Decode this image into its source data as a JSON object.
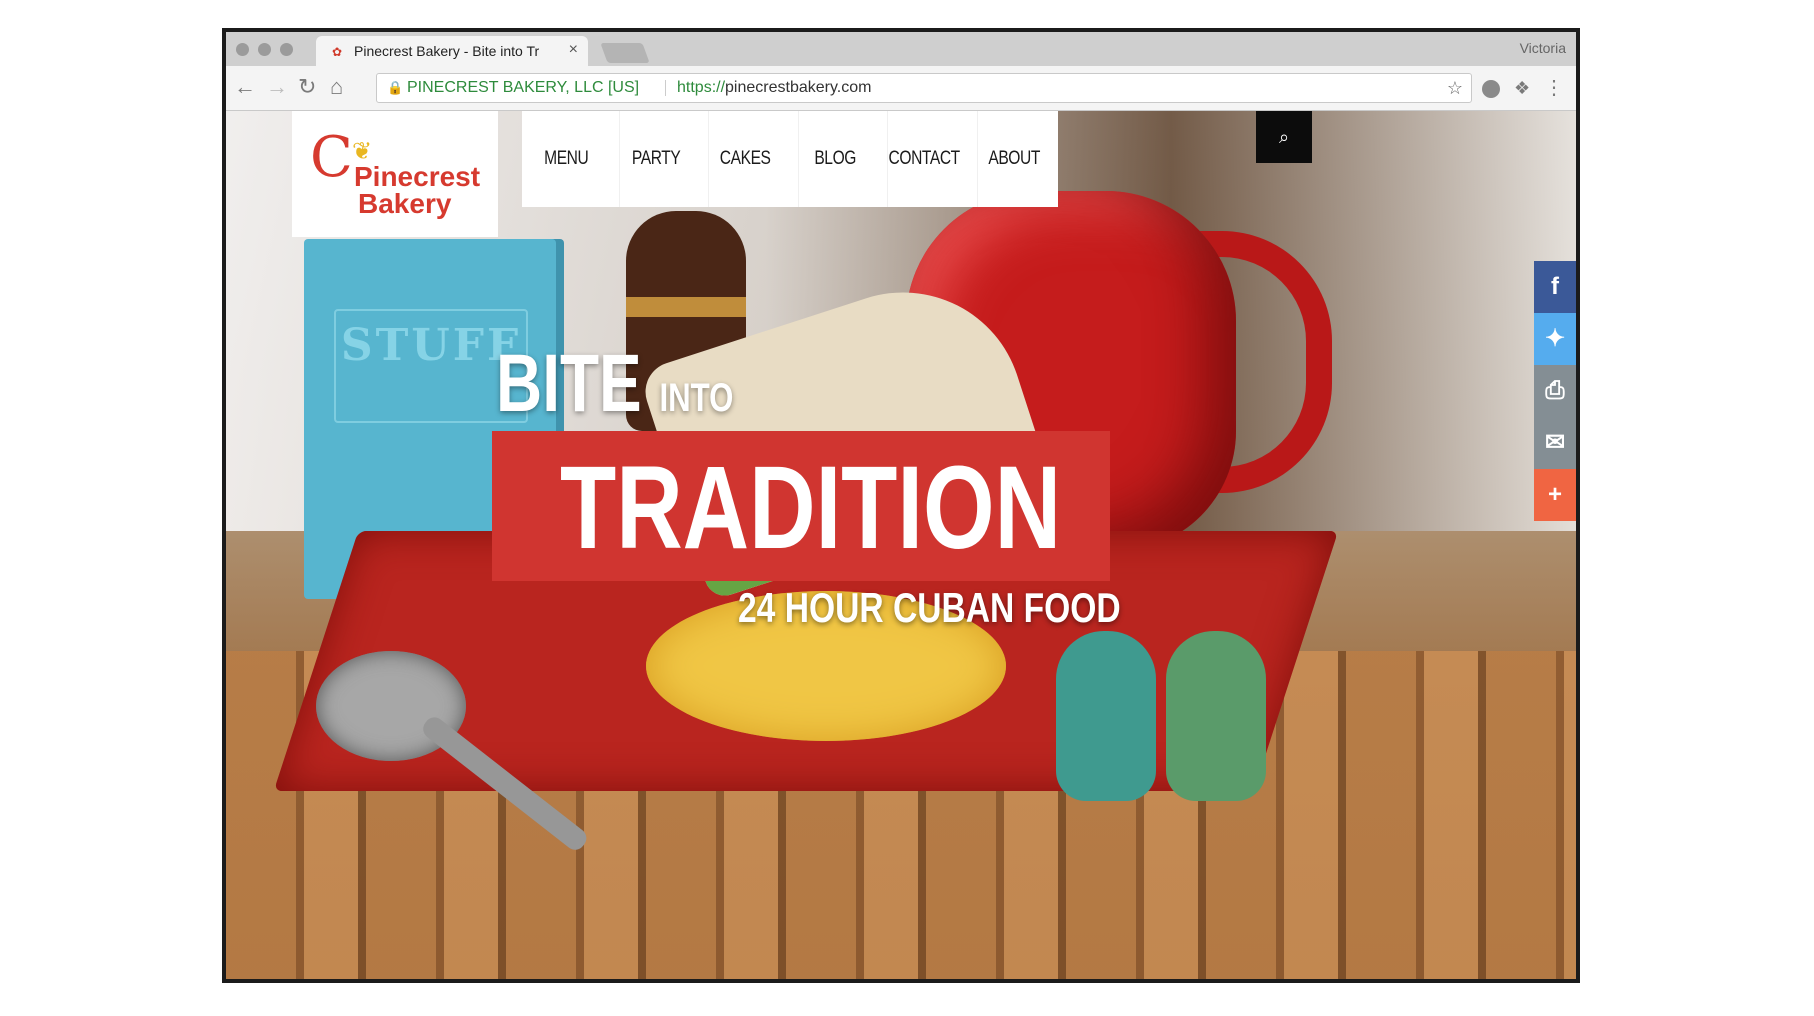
{
  "browser": {
    "tab_title": "Pinecrest Bakery - Bite into Tr",
    "tab_favicon_icon": "pinecrest-favicon-icon",
    "tab_close": "×",
    "profile_name": "Victoria",
    "cert_label": "PINECREST BAKERY, LLC [US]",
    "url_protocol": "https://",
    "url_host": "pinecrestbakery.com",
    "icons": {
      "back": "←",
      "forward": "→",
      "reload": "↻",
      "home": "⌂",
      "lock": "🔒",
      "star": "☆",
      "menu": "⋮",
      "dropbox": "❖"
    }
  },
  "site": {
    "logo": {
      "line1": "Pinecrest",
      "line2": "Bakery",
      "mark": "C",
      "wheat": "❦",
      "brand_color": "#d63a2f"
    },
    "nav": [
      "MENU",
      "PARTY",
      "CAKES",
      "BLOG",
      "CONTACT",
      "ABOUT"
    ],
    "search_icon": "⌕",
    "hero": {
      "bite": "BITE",
      "into": "INTO",
      "tradition": "TRADITION",
      "tagline": "24 HOUR CUBAN FOOD",
      "banner_color": "#d03530"
    },
    "background_book_text": "STUFF",
    "share": [
      {
        "name": "facebook",
        "glyph": "f",
        "color": "#3b5998"
      },
      {
        "name": "twitter",
        "glyph": "✦",
        "color": "#55acee"
      },
      {
        "name": "print",
        "glyph": "⎙",
        "color": "#848e94"
      },
      {
        "name": "email",
        "glyph": "✉",
        "color": "#848e94"
      },
      {
        "name": "more",
        "glyph": "+",
        "color": "#f06542"
      }
    ]
  }
}
